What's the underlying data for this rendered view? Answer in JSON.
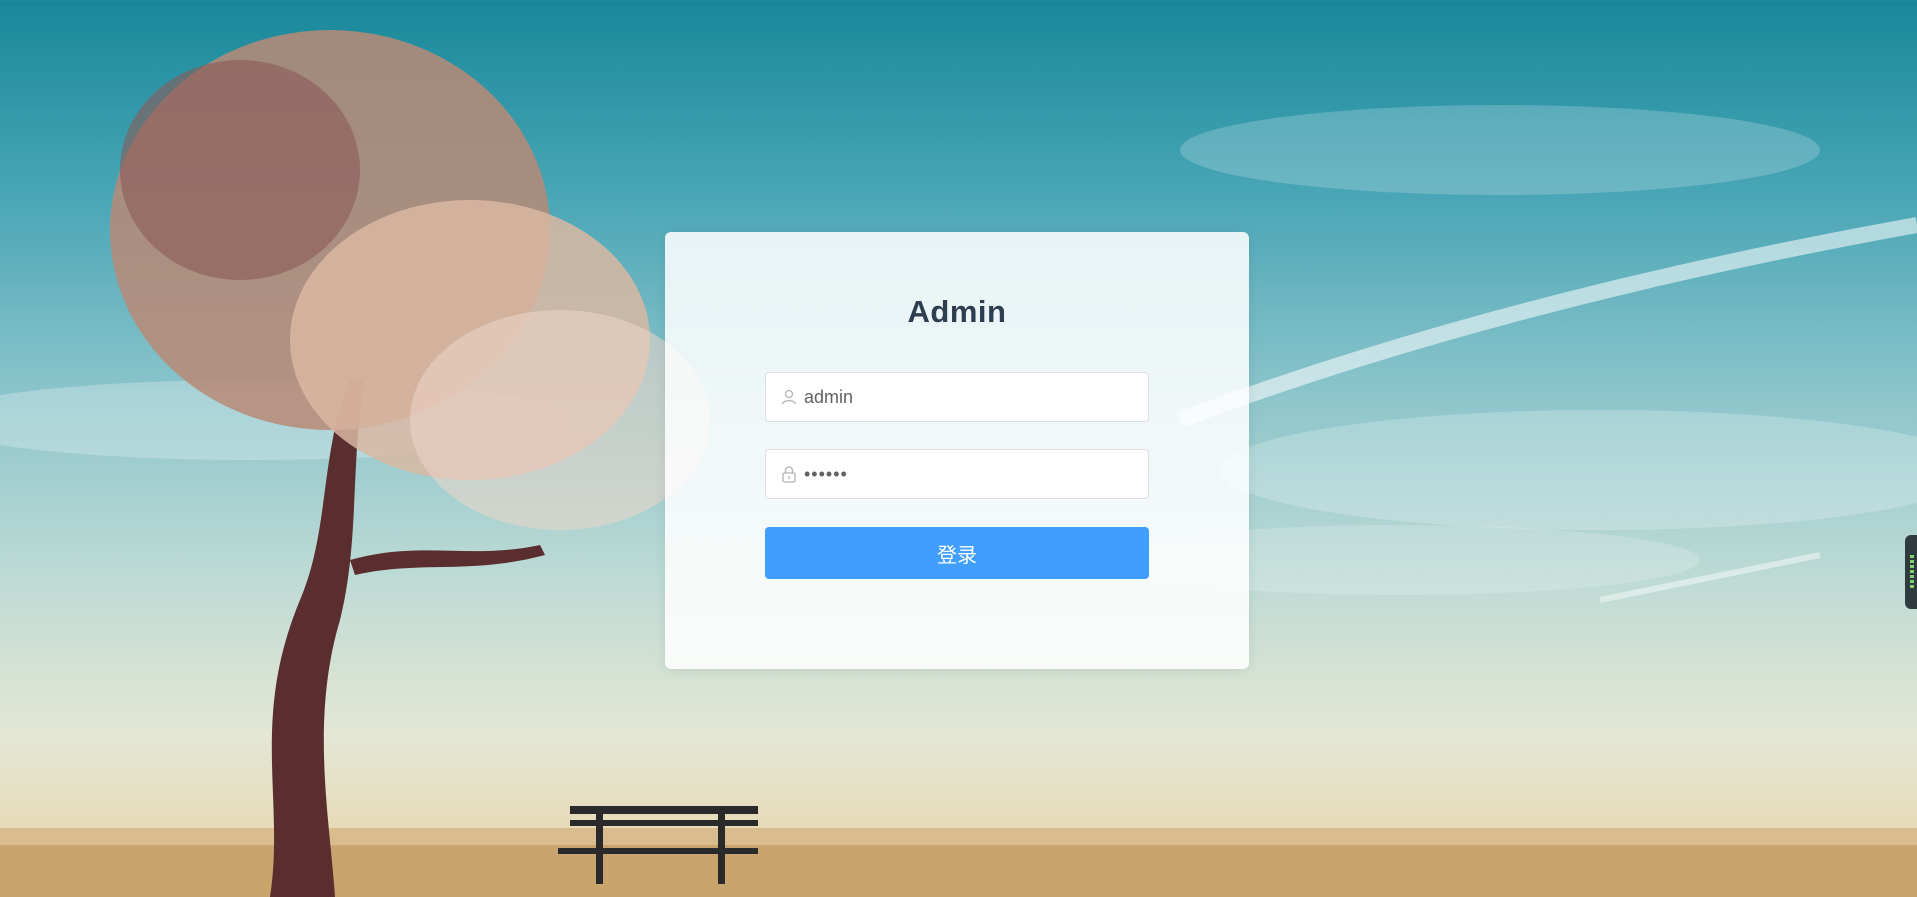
{
  "background": {
    "scene": "sky-tree-bench-photo"
  },
  "login": {
    "title": "Admin",
    "username": {
      "value": "admin",
      "icon": "user-icon"
    },
    "password": {
      "value": "••••••",
      "icon": "lock-icon"
    },
    "submit_label": "登录",
    "accent_color": "#409eff"
  }
}
